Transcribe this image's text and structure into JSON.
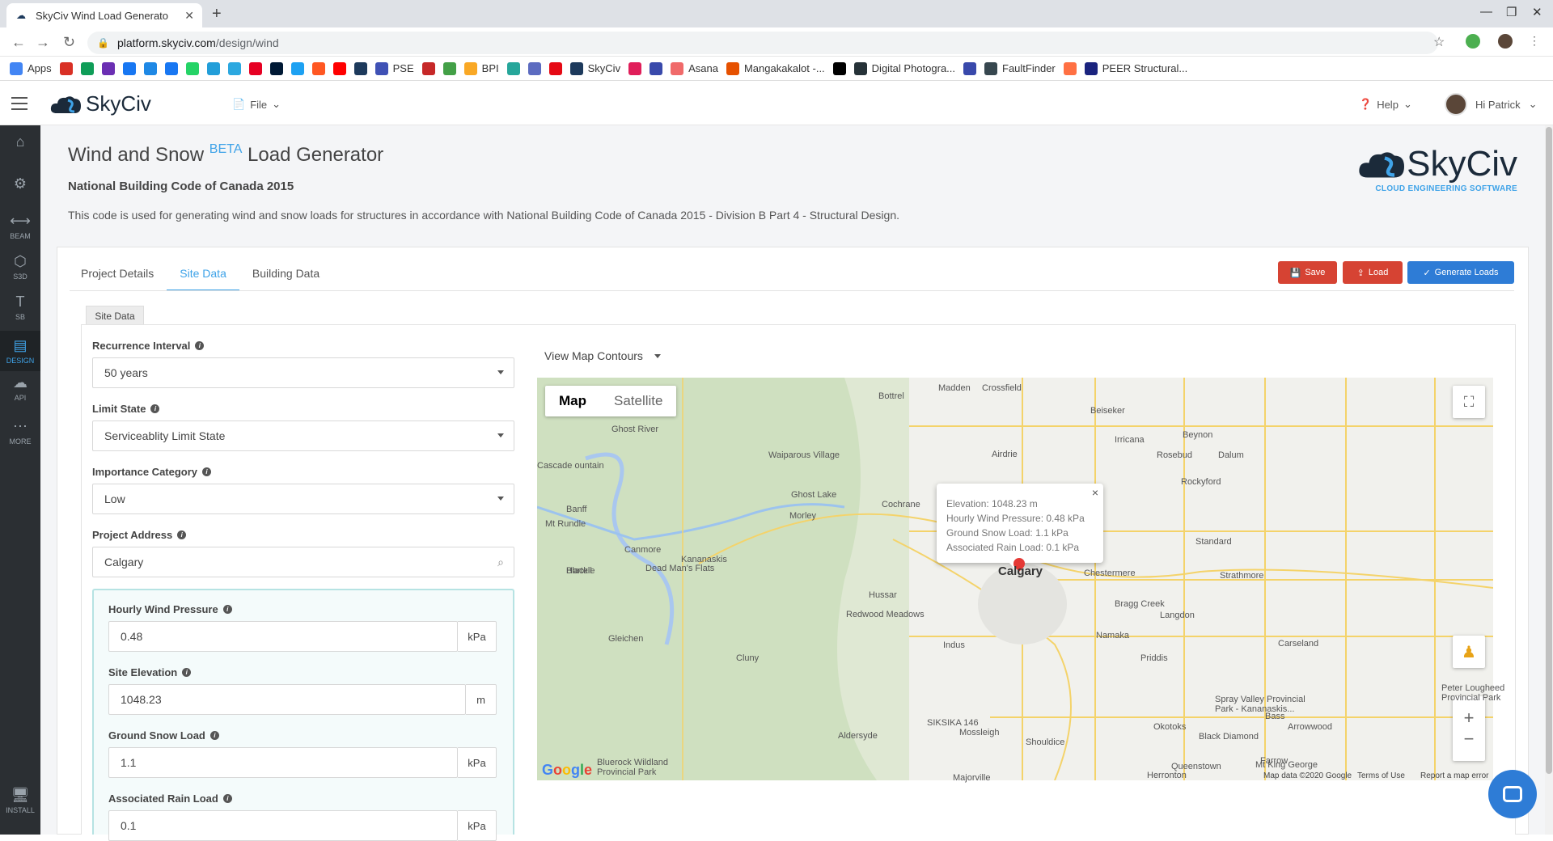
{
  "browser": {
    "tab_title": "SkyCiv Wind Load Generato",
    "url_host": "platform.skyciv.com",
    "url_path": "/design/wind",
    "bookmarks": [
      {
        "label": "Apps",
        "color": "#4285f4"
      },
      {
        "label": "",
        "color": "#d93025"
      },
      {
        "label": "",
        "color": "#0f9d58"
      },
      {
        "label": "",
        "color": "#6b2fb3"
      },
      {
        "label": "",
        "color": "#1877f2"
      },
      {
        "label": "",
        "color": "#1e88e5"
      },
      {
        "label": "",
        "color": "#1877f2"
      },
      {
        "label": "",
        "color": "#25d366"
      },
      {
        "label": "",
        "color": "#229ed9"
      },
      {
        "label": "",
        "color": "#2ca8e0"
      },
      {
        "label": "",
        "color": "#e60023"
      },
      {
        "label": "",
        "color": "#001935"
      },
      {
        "label": "",
        "color": "#1da1f2"
      },
      {
        "label": "",
        "color": "#ff5722"
      },
      {
        "label": "",
        "color": "#ff0000"
      },
      {
        "label": "",
        "color": "#1d3a5c"
      },
      {
        "label": "PSE",
        "color": "#3f51b5"
      },
      {
        "label": "",
        "color": "#c62828"
      },
      {
        "label": "",
        "color": "#43a047"
      },
      {
        "label": "BPI",
        "color": "#f9a825"
      },
      {
        "label": "",
        "color": "#26a69a"
      },
      {
        "label": "",
        "color": "#5c6bc0"
      },
      {
        "label": "",
        "color": "#e50914"
      },
      {
        "label": "SkyCiv",
        "color": "#1d3a5c"
      },
      {
        "label": "",
        "color": "#e01e5a"
      },
      {
        "label": "",
        "color": "#3949ab"
      },
      {
        "label": "Asana",
        "color": "#f06a6a"
      },
      {
        "label": "Mangakakalot -...",
        "color": "#e65100"
      },
      {
        "label": "",
        "color": "#000000"
      },
      {
        "label": "Digital Photogra...",
        "color": "#263238"
      },
      {
        "label": "",
        "color": "#3949ab"
      },
      {
        "label": "FaultFinder",
        "color": "#37474f"
      },
      {
        "label": "",
        "color": "#ff7043"
      },
      {
        "label": "PEER Structural...",
        "color": "#1a237e"
      }
    ]
  },
  "app": {
    "logo_text": "SkyCiv",
    "file_menu": "File",
    "help_menu": "Help",
    "user_greeting": "Hi Patrick"
  },
  "sidebar": [
    {
      "label": "",
      "icon": "home-icon"
    },
    {
      "label": "",
      "icon": "gear-icon"
    },
    {
      "label": "BEAM",
      "icon": "beam-icon"
    },
    {
      "label": "S3D",
      "icon": "cube-icon"
    },
    {
      "label": "SB",
      "icon": "section-icon"
    },
    {
      "label": "DESIGN",
      "icon": "design-icon"
    },
    {
      "label": "API",
      "icon": "cloud-icon"
    },
    {
      "label": "MORE",
      "icon": "more-icon"
    },
    {
      "label": "INSTALL",
      "icon": "monitor-icon"
    }
  ],
  "page": {
    "title_part1": "Wind and Snow",
    "title_beta": "BETA",
    "title_part2": "Load Generator",
    "subtitle": "National Building Code of Canada 2015",
    "description": "This code is used for generating wind and snow loads for structures in accordance with National Building Code of Canada 2015 - Division B Part 4 - Structural Design.",
    "brand_name": "SkyCiv",
    "brand_tagline": "CLOUD ENGINEERING SOFTWARE"
  },
  "tabs": [
    "Project Details",
    "Site Data",
    "Building Data"
  ],
  "actions": {
    "save": "Save",
    "load": "Load",
    "generate": "Generate Loads"
  },
  "site": {
    "section_label": "Site Data",
    "recurrence_label": "Recurrence Interval",
    "recurrence_value": "50 years",
    "limit_state_label": "Limit State",
    "limit_state_value": "Serviceablity Limit State",
    "importance_label": "Importance Category",
    "importance_value": "Low",
    "address_label": "Project Address",
    "address_value": "Calgary",
    "wind_label": "Hourly Wind Pressure",
    "wind_value": "0.48",
    "wind_unit": "kPa",
    "elev_label": "Site Elevation",
    "elev_value": "1048.23",
    "elev_unit": "m",
    "snow_label": "Ground Snow Load",
    "snow_value": "1.1",
    "snow_unit": "kPa",
    "rain_label": "Associated Rain Load",
    "rain_value": "0.1",
    "rain_unit": "kPa"
  },
  "map": {
    "contours_label": "View Map Contours",
    "type_map": "Map",
    "type_satellite": "Satellite",
    "popup_elevation": "Elevation: 1048.23 m",
    "popup_wind": "Hourly Wind Pressure: 0.48 kPa",
    "popup_snow": "Ground Snow Load: 1.1 kPa",
    "popup_rain": "Associated Rain Load: 0.1 kPa",
    "city": "Calgary",
    "places": [
      "Madden",
      "Crossfield",
      "Bottrel",
      "Beiseker",
      "Irricana",
      "Beynon",
      "Airdrie",
      "Rosebud",
      "Dalum",
      "Ghost River",
      "Waiparous Village",
      "Rockyford",
      "Ghost Lake",
      "Cochrane",
      "Morley",
      "Standard",
      "Cascade ountain",
      "Banff",
      "Mt Rundle",
      "Canmore",
      "Kananaskis",
      "Dead Man's Flats",
      "Chestermere",
      "Strathmore",
      "Hussar",
      "Redwood Meadows",
      "Bragg Creek",
      "Langdon",
      "Namaka",
      "Indus",
      "Priddis",
      "Carseland",
      "Gleichen",
      "Cluny",
      "Spray Valley Provincial Park - Kananaskis...",
      "Peter Lougheed Provincial Park",
      "SIKSIKA 146",
      "Bass",
      "Okotoks",
      "Arrowwood",
      "Mossleigh",
      "Shouldice",
      "Black Diamond",
      "Aldersyde",
      "Farrow",
      "Bluerock Wildland Provincial Park",
      "Queenstown",
      "Mt King George",
      "Herronton",
      "Majorville",
      "Blackie",
      "Hartell"
    ],
    "attribution": "Map data ©2020 Google",
    "terms": "Terms of Use",
    "report": "Report a map error",
    "google": "Google"
  },
  "colors": {
    "accent_blue": "#3fa3e8",
    "danger_red": "#d64333",
    "primary_blue": "#2e7cd6",
    "sidebar_bg": "#2b2f33"
  }
}
